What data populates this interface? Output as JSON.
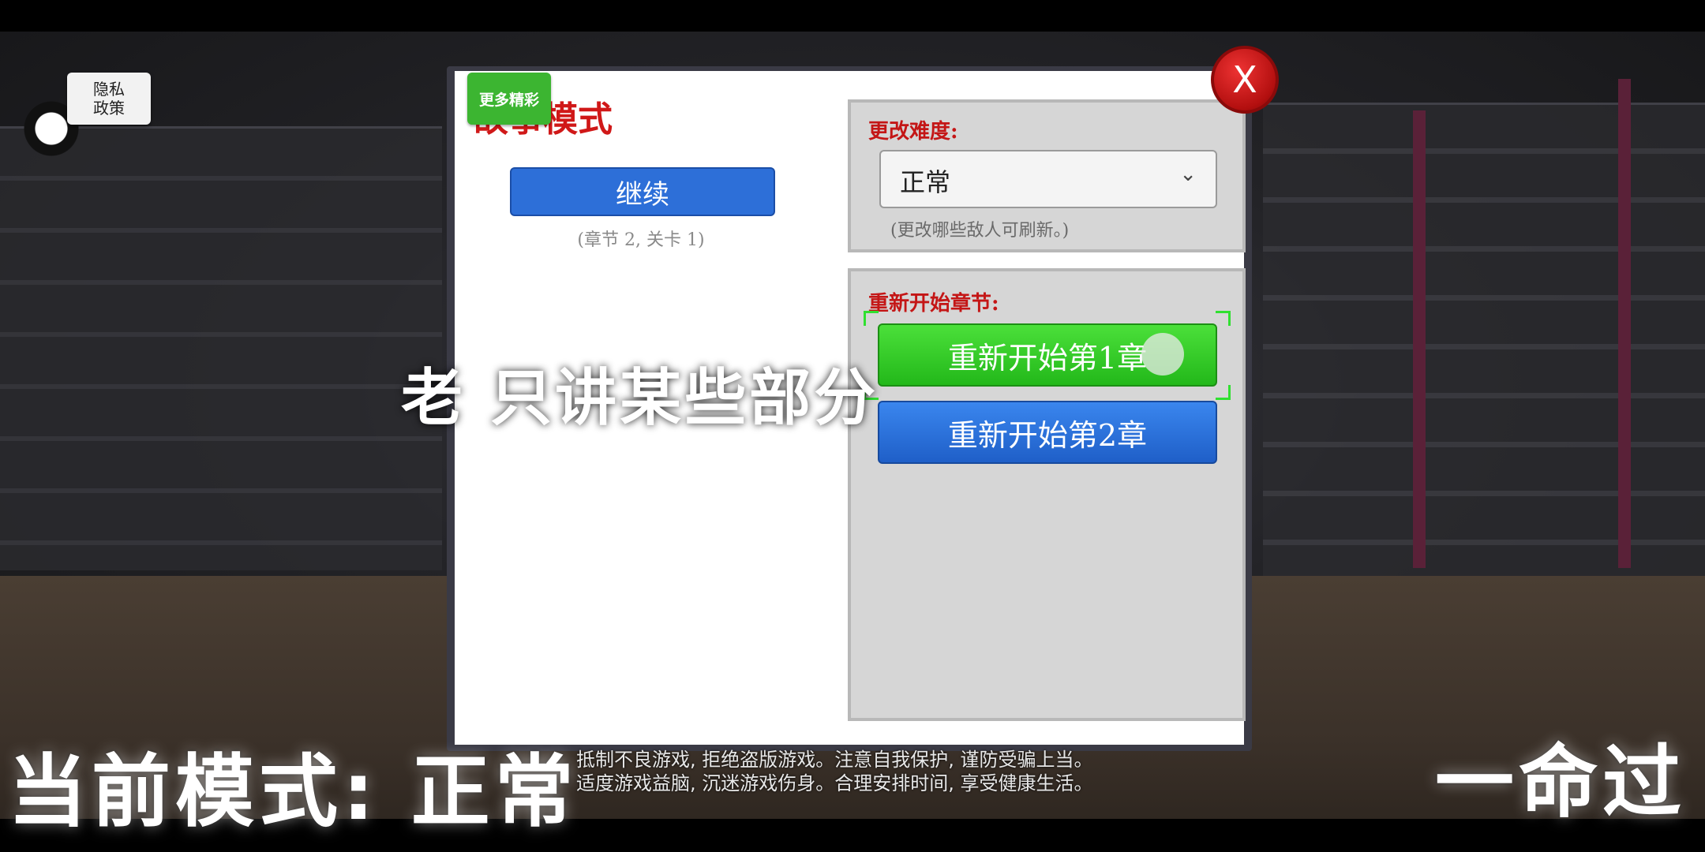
{
  "privacy_button": {
    "line1": "隐私",
    "line2": "政策"
  },
  "dialog": {
    "more_button": "更多精彩",
    "mode_title": "故事模式",
    "continue_button": "继续",
    "progress_note": "(章节 2, 关卡 1)",
    "difficulty": {
      "label": "更改难度:",
      "selected": "正常",
      "note": "(更改哪些敌人可刷新。)"
    },
    "restart": {
      "label": "重新开始章节:",
      "buttons": [
        "重新开始第1章",
        "重新开始第2章"
      ]
    },
    "close_label": "X"
  },
  "overlay": {
    "subtitle": "老          只讲某些部分",
    "mode_caption": "当前模式: 正常",
    "life_caption": "一命过"
  },
  "notice": {
    "line1": "抵制不良游戏, 拒绝盗版游戏。注意自我保护, 谨防受骗上当。",
    "line2": "适度游戏益脑, 沉迷游戏伤身。合理安排时间, 享受健康生活。"
  },
  "colors": {
    "accent_red": "#d01818",
    "continue_blue": "#2d6fd8",
    "restart_green": "#23b81a",
    "more_green": "#3cb531"
  }
}
